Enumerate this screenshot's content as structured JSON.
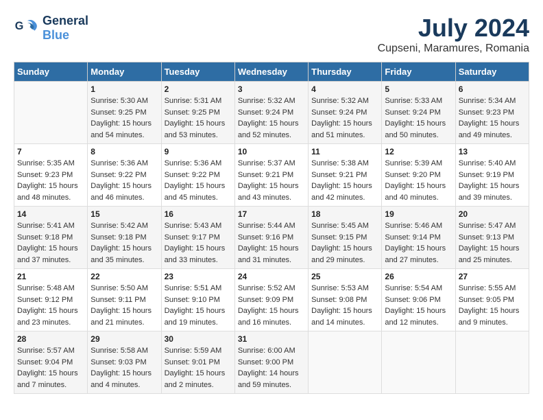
{
  "header": {
    "logo_line1": "General",
    "logo_line2": "Blue",
    "title": "July 2024",
    "subtitle": "Cupseni, Maramures, Romania"
  },
  "weekdays": [
    "Sunday",
    "Monday",
    "Tuesday",
    "Wednesday",
    "Thursday",
    "Friday",
    "Saturday"
  ],
  "weeks": [
    [
      {
        "day": "",
        "info": ""
      },
      {
        "day": "1",
        "info": "Sunrise: 5:30 AM\nSunset: 9:25 PM\nDaylight: 15 hours\nand 54 minutes."
      },
      {
        "day": "2",
        "info": "Sunrise: 5:31 AM\nSunset: 9:25 PM\nDaylight: 15 hours\nand 53 minutes."
      },
      {
        "day": "3",
        "info": "Sunrise: 5:32 AM\nSunset: 9:24 PM\nDaylight: 15 hours\nand 52 minutes."
      },
      {
        "day": "4",
        "info": "Sunrise: 5:32 AM\nSunset: 9:24 PM\nDaylight: 15 hours\nand 51 minutes."
      },
      {
        "day": "5",
        "info": "Sunrise: 5:33 AM\nSunset: 9:24 PM\nDaylight: 15 hours\nand 50 minutes."
      },
      {
        "day": "6",
        "info": "Sunrise: 5:34 AM\nSunset: 9:23 PM\nDaylight: 15 hours\nand 49 minutes."
      }
    ],
    [
      {
        "day": "7",
        "info": "Sunrise: 5:35 AM\nSunset: 9:23 PM\nDaylight: 15 hours\nand 48 minutes."
      },
      {
        "day": "8",
        "info": "Sunrise: 5:36 AM\nSunset: 9:22 PM\nDaylight: 15 hours\nand 46 minutes."
      },
      {
        "day": "9",
        "info": "Sunrise: 5:36 AM\nSunset: 9:22 PM\nDaylight: 15 hours\nand 45 minutes."
      },
      {
        "day": "10",
        "info": "Sunrise: 5:37 AM\nSunset: 9:21 PM\nDaylight: 15 hours\nand 43 minutes."
      },
      {
        "day": "11",
        "info": "Sunrise: 5:38 AM\nSunset: 9:21 PM\nDaylight: 15 hours\nand 42 minutes."
      },
      {
        "day": "12",
        "info": "Sunrise: 5:39 AM\nSunset: 9:20 PM\nDaylight: 15 hours\nand 40 minutes."
      },
      {
        "day": "13",
        "info": "Sunrise: 5:40 AM\nSunset: 9:19 PM\nDaylight: 15 hours\nand 39 minutes."
      }
    ],
    [
      {
        "day": "14",
        "info": "Sunrise: 5:41 AM\nSunset: 9:18 PM\nDaylight: 15 hours\nand 37 minutes."
      },
      {
        "day": "15",
        "info": "Sunrise: 5:42 AM\nSunset: 9:18 PM\nDaylight: 15 hours\nand 35 minutes."
      },
      {
        "day": "16",
        "info": "Sunrise: 5:43 AM\nSunset: 9:17 PM\nDaylight: 15 hours\nand 33 minutes."
      },
      {
        "day": "17",
        "info": "Sunrise: 5:44 AM\nSunset: 9:16 PM\nDaylight: 15 hours\nand 31 minutes."
      },
      {
        "day": "18",
        "info": "Sunrise: 5:45 AM\nSunset: 9:15 PM\nDaylight: 15 hours\nand 29 minutes."
      },
      {
        "day": "19",
        "info": "Sunrise: 5:46 AM\nSunset: 9:14 PM\nDaylight: 15 hours\nand 27 minutes."
      },
      {
        "day": "20",
        "info": "Sunrise: 5:47 AM\nSunset: 9:13 PM\nDaylight: 15 hours\nand 25 minutes."
      }
    ],
    [
      {
        "day": "21",
        "info": "Sunrise: 5:48 AM\nSunset: 9:12 PM\nDaylight: 15 hours\nand 23 minutes."
      },
      {
        "day": "22",
        "info": "Sunrise: 5:50 AM\nSunset: 9:11 PM\nDaylight: 15 hours\nand 21 minutes."
      },
      {
        "day": "23",
        "info": "Sunrise: 5:51 AM\nSunset: 9:10 PM\nDaylight: 15 hours\nand 19 minutes."
      },
      {
        "day": "24",
        "info": "Sunrise: 5:52 AM\nSunset: 9:09 PM\nDaylight: 15 hours\nand 16 minutes."
      },
      {
        "day": "25",
        "info": "Sunrise: 5:53 AM\nSunset: 9:08 PM\nDaylight: 15 hours\nand 14 minutes."
      },
      {
        "day": "26",
        "info": "Sunrise: 5:54 AM\nSunset: 9:06 PM\nDaylight: 15 hours\nand 12 minutes."
      },
      {
        "day": "27",
        "info": "Sunrise: 5:55 AM\nSunset: 9:05 PM\nDaylight: 15 hours\nand 9 minutes."
      }
    ],
    [
      {
        "day": "28",
        "info": "Sunrise: 5:57 AM\nSunset: 9:04 PM\nDaylight: 15 hours\nand 7 minutes."
      },
      {
        "day": "29",
        "info": "Sunrise: 5:58 AM\nSunset: 9:03 PM\nDaylight: 15 hours\nand 4 minutes."
      },
      {
        "day": "30",
        "info": "Sunrise: 5:59 AM\nSunset: 9:01 PM\nDaylight: 15 hours\nand 2 minutes."
      },
      {
        "day": "31",
        "info": "Sunrise: 6:00 AM\nSunset: 9:00 PM\nDaylight: 14 hours\nand 59 minutes."
      },
      {
        "day": "",
        "info": ""
      },
      {
        "day": "",
        "info": ""
      },
      {
        "day": "",
        "info": ""
      }
    ]
  ]
}
